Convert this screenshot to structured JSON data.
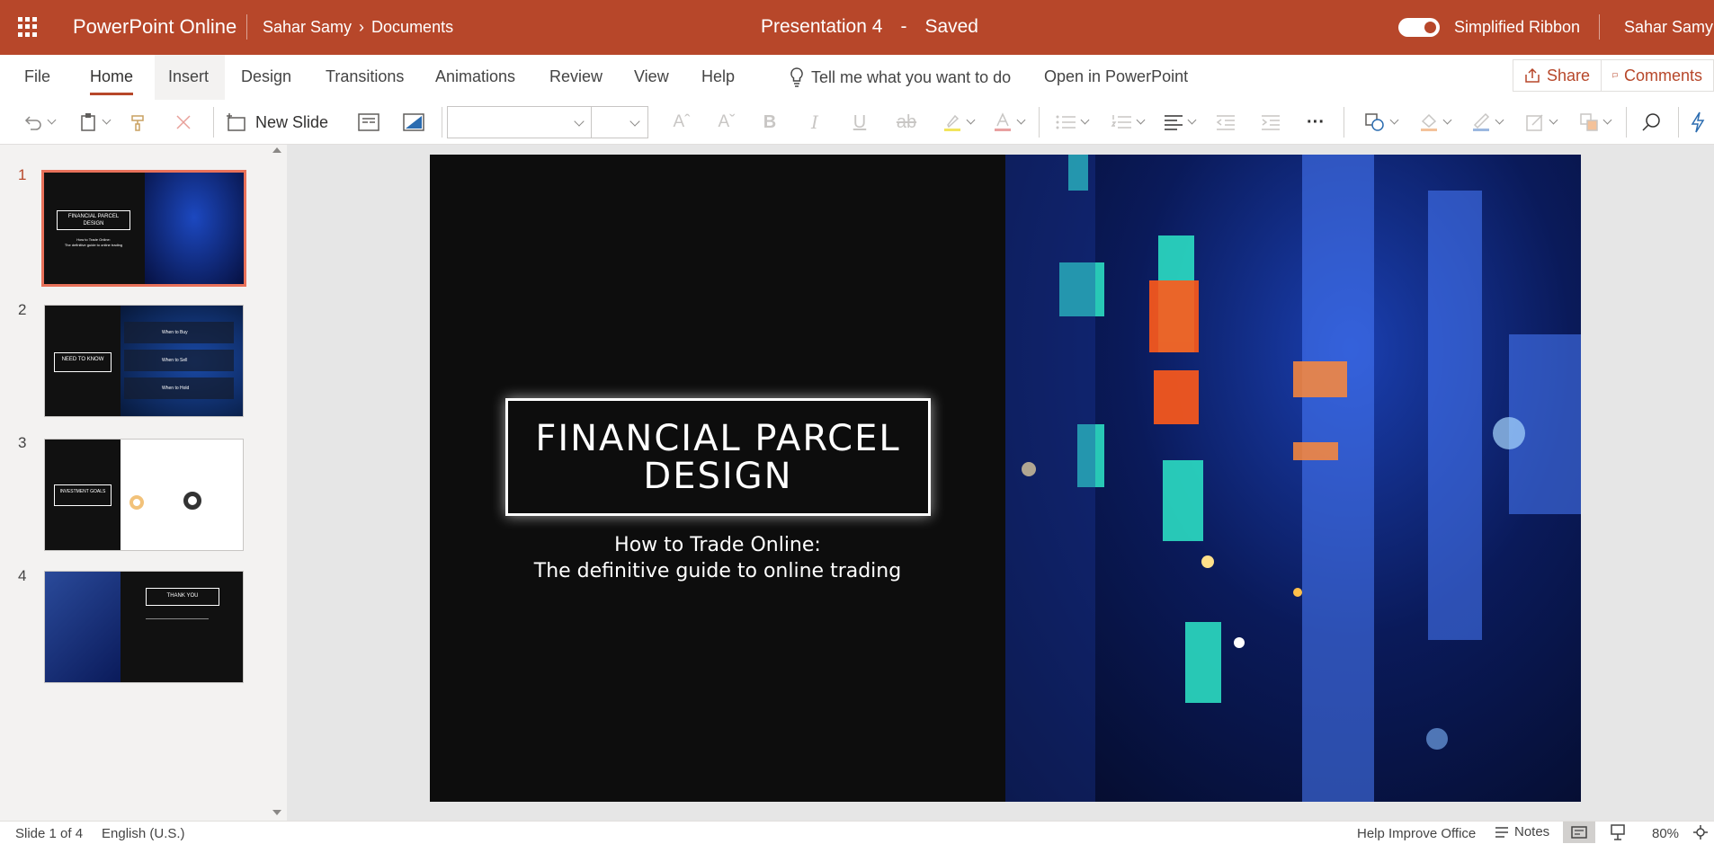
{
  "titlebar": {
    "app_name": "PowerPoint Online",
    "breadcrumb_user": "Sahar Samy",
    "breadcrumb_folder": "Documents",
    "doc_title": "Presentation 4",
    "doc_separator": "-",
    "doc_status": "Saved",
    "ribbon_toggle_label": "Simplified Ribbon",
    "user_name": "Sahar Samy",
    "accent_color": "#b7472a"
  },
  "tabs": {
    "items": [
      "File",
      "Home",
      "Insert",
      "Design",
      "Transitions",
      "Animations",
      "Review",
      "View",
      "Help"
    ],
    "active": "Home",
    "tell_me": "Tell me what you want to do",
    "open_in_app": "Open in PowerPoint",
    "share": "Share",
    "comments": "Comments"
  },
  "toolbar": {
    "new_slide": "New Slide",
    "icons": [
      "undo-icon",
      "paste-icon",
      "format-painter-icon",
      "delete-icon",
      "new-slide-icon",
      "layout-icon",
      "background-icon",
      "font-family-select",
      "font-size-select",
      "grow-font-icon",
      "shrink-font-icon",
      "bold-icon",
      "italic-icon",
      "underline-icon",
      "strikethrough-icon",
      "highlight-icon",
      "font-color-icon",
      "bullets-icon",
      "numbering-icon",
      "align-icon",
      "decrease-indent-icon",
      "increase-indent-icon",
      "more-icon",
      "shapes-icon",
      "shape-fill-icon",
      "shape-outline-icon",
      "format-icon",
      "arrange-icon",
      "find-icon",
      "designer-icon"
    ]
  },
  "thumbnails": [
    {
      "number": "1",
      "title": "FINANCIAL PARCEL DESIGN",
      "subtitle1": "How to Trade Online:",
      "subtitle2": "The definitive guide to online trading"
    },
    {
      "number": "2",
      "title": "NEED TO KNOW",
      "items": [
        "When to Buy",
        "When to Sell",
        "When to Hold"
      ]
    },
    {
      "number": "3",
      "title": "INVESTMENT GOALS"
    },
    {
      "number": "4",
      "title": "THANK YOU"
    }
  ],
  "slide": {
    "title_line1": "FINANCIAL PARCEL",
    "title_line2": "DESIGN",
    "subtitle_line1": "How to Trade Online:",
    "subtitle_line2": "The definitive guide to online trading"
  },
  "status": {
    "slide_count": "Slide 1 of 4",
    "language": "English (U.S.)",
    "help_improve": "Help Improve Office",
    "notes": "Notes",
    "zoom": "80%"
  }
}
